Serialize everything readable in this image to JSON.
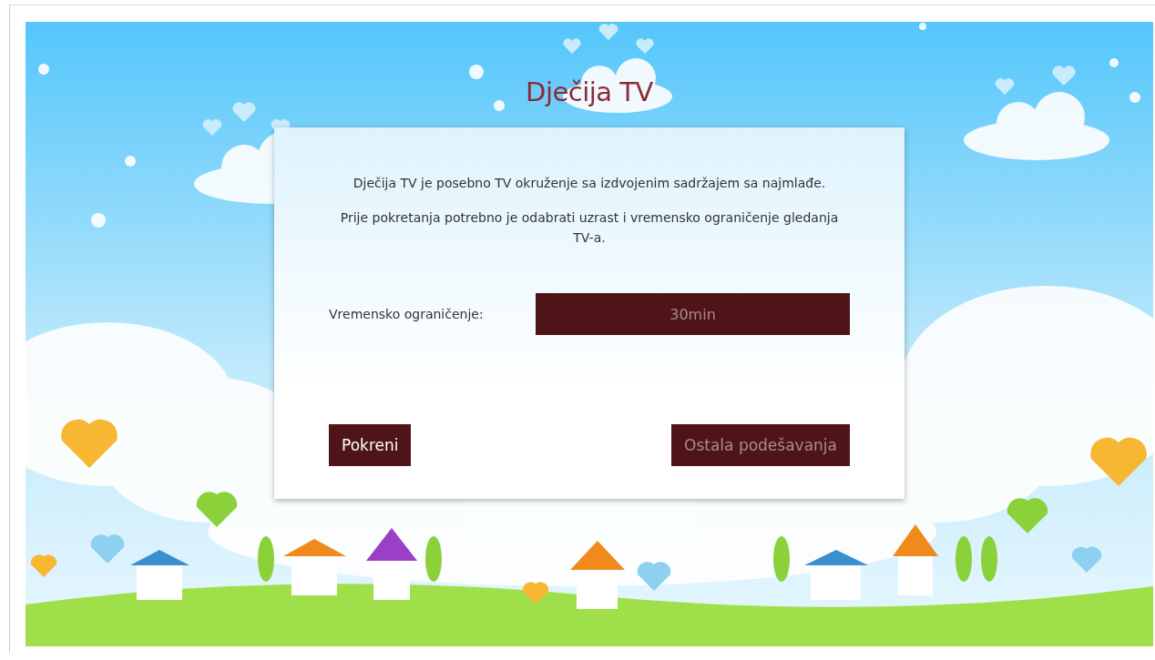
{
  "title": "Dječija TV",
  "intro": [
    "Dječija TV je posebno TV okruženje sa izdvojenim sadržajem sa najmlađe.",
    "Prije pokretanja potrebno je odabrati uzrast i vremensko ograničenje gledanja TV-a."
  ],
  "time_limit": {
    "label": "Vremensko ograničenje:",
    "value": "30min",
    "focused": false
  },
  "buttons": [
    {
      "label": "Pokreni",
      "focused": true
    },
    {
      "label": "Ostala podešavanja",
      "focused": false
    }
  ]
}
